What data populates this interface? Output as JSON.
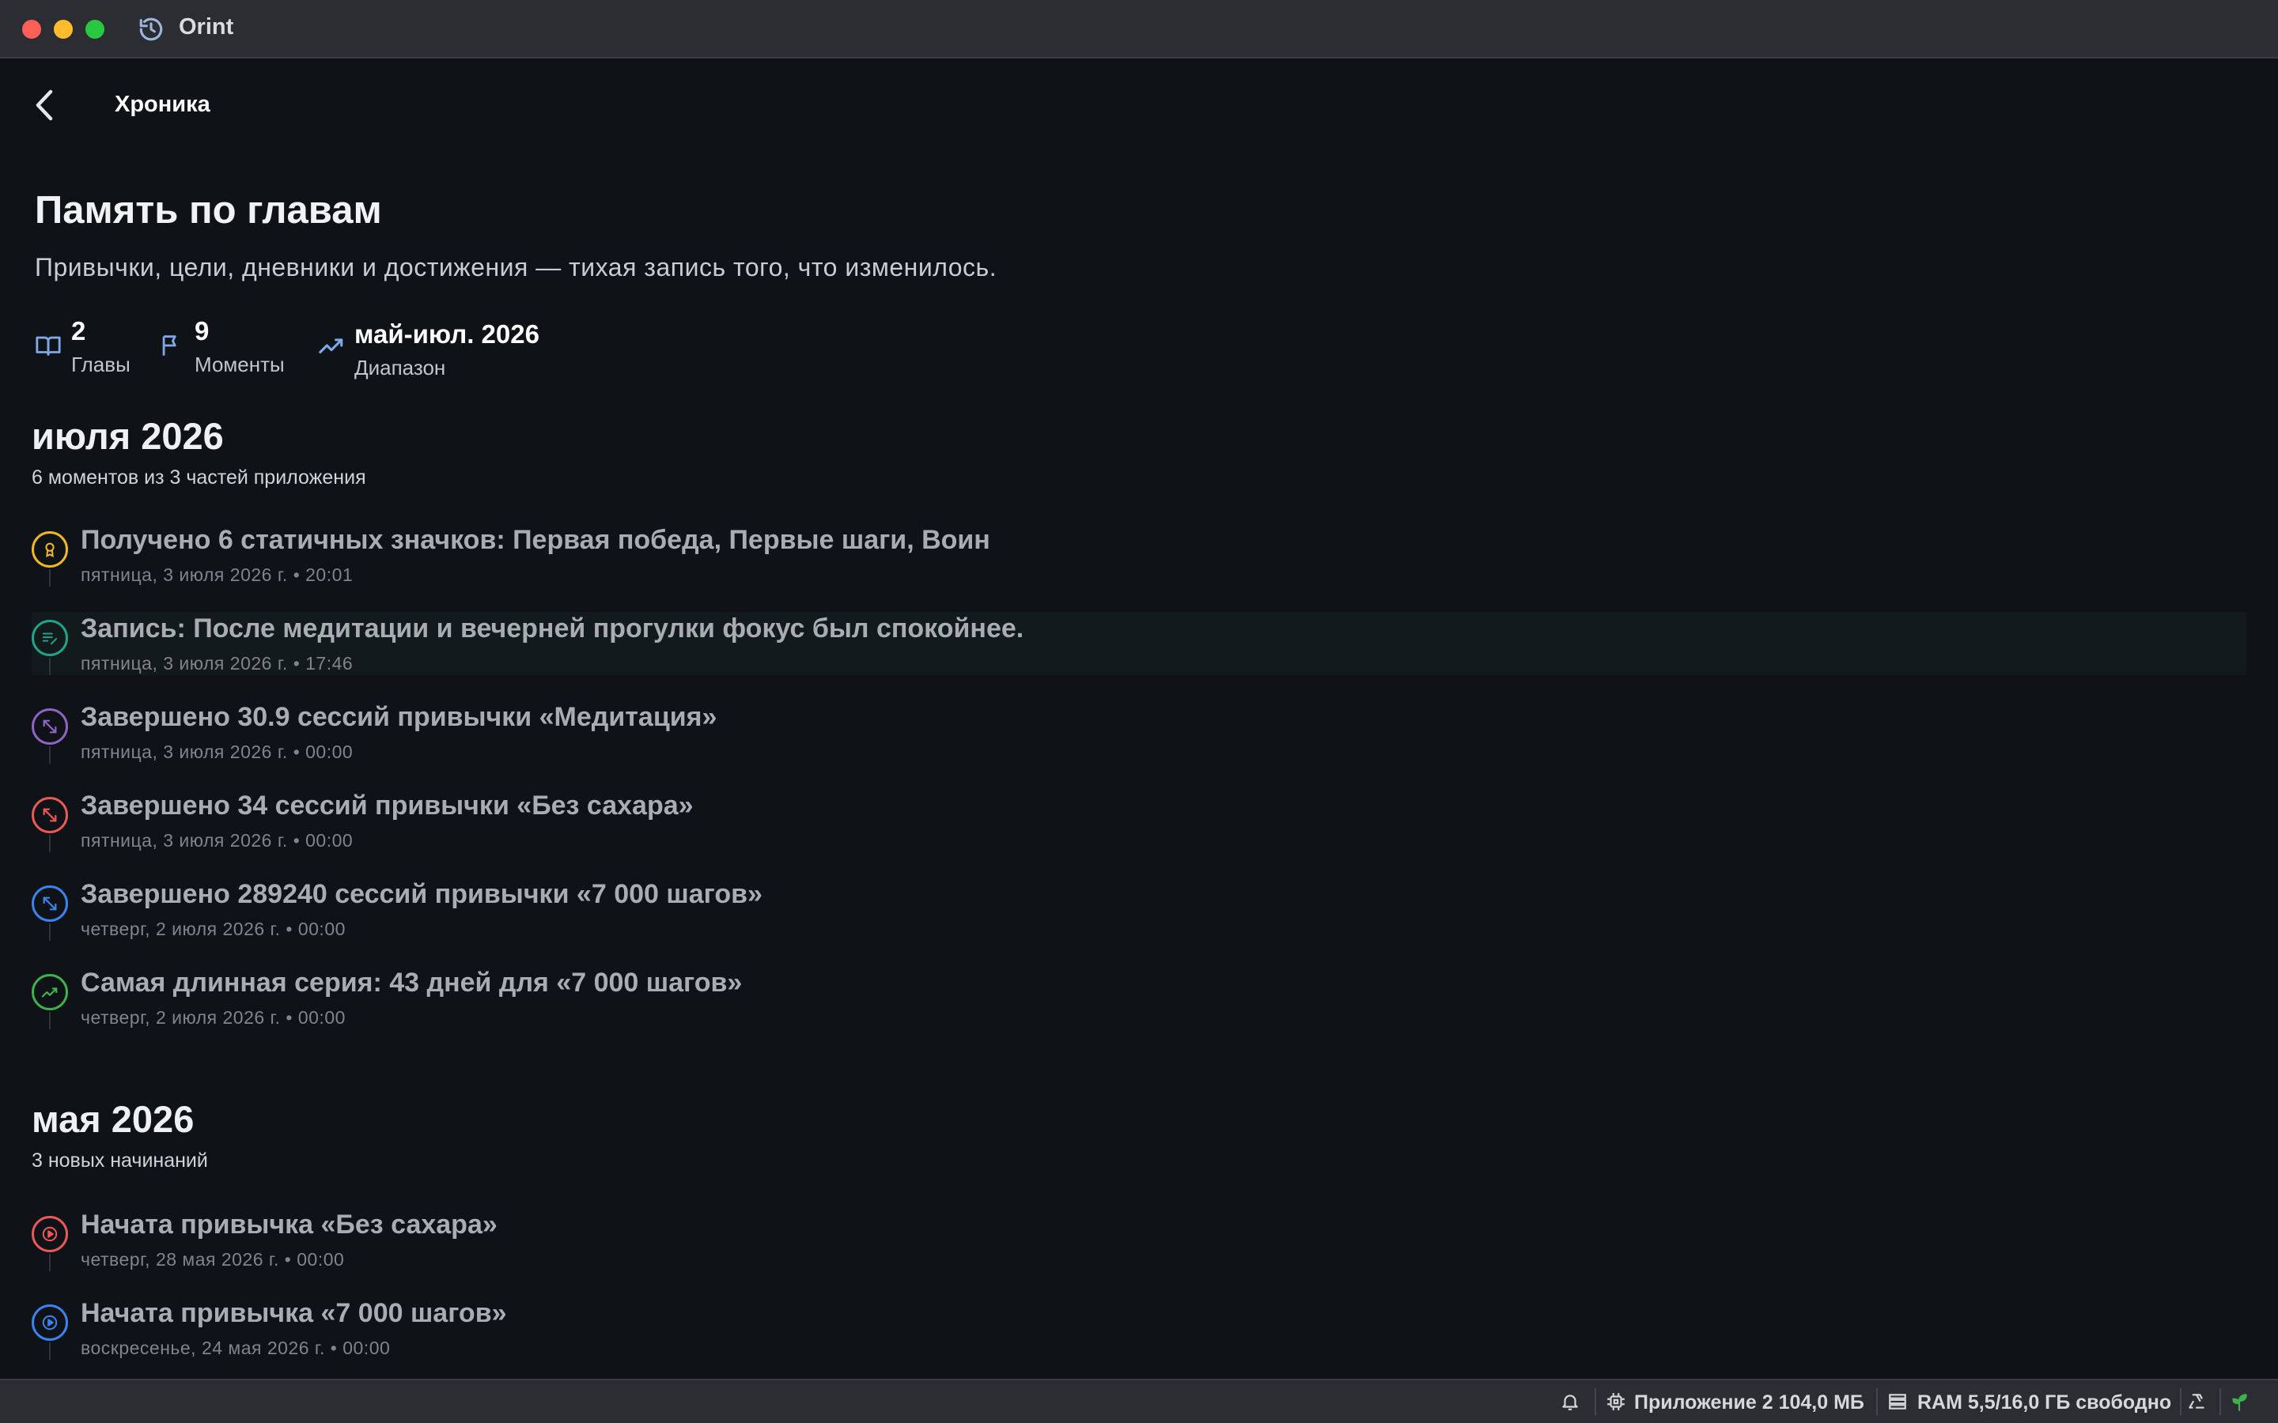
{
  "app": {
    "title": "Orint"
  },
  "header": {
    "title": "Хроника"
  },
  "page": {
    "title": "Память по главам",
    "subtitle": "Привычки, цели, дневники и достижения — тихая запись того, что изменилось."
  },
  "stats": [
    {
      "value": "2",
      "label": "Главы",
      "icon": "book-icon"
    },
    {
      "value": "9",
      "label": "Моменты",
      "icon": "flag-icon"
    },
    {
      "value": "май-июл. 2026",
      "label": "Диапазон",
      "icon": "trend-icon"
    }
  ],
  "sections": [
    {
      "title": "июля 2026",
      "subtitle": "6 моментов из 3 частей приложения",
      "events": [
        {
          "title": "Получено 6 статичных значков: Первая победа, Первые шаги, Воин",
          "date": "пятница, 3 июля 2026 г. • 20:01",
          "icon": "badge-icon",
          "color": "#f2b824"
        },
        {
          "title": "Запись: После медитации и вечерней прогулки фокус был спокойнее.",
          "date": "пятница, 3 июля 2026 г. • 17:46",
          "icon": "journal-icon",
          "color": "#1fa38a"
        },
        {
          "title": "Завершено 30.9 сессий привычки «Медитация»",
          "date": "пятница, 3 июля 2026 г. • 00:00",
          "icon": "arrows-icon",
          "color": "#8e63c4"
        },
        {
          "title": "Завершено 34 сессий привычки «Без сахара»",
          "date": "пятница, 3 июля 2026 г. • 00:00",
          "icon": "arrows-icon",
          "color": "#e85a57"
        },
        {
          "title": "Завершено 289240 сессий привычки «7 000 шагов»",
          "date": "четверг, 2 июля 2026 г. • 00:00",
          "icon": "arrows-icon",
          "color": "#3a84f0"
        },
        {
          "title": "Самая длинная серия: 43 дней для «7 000 шагов»",
          "date": "четверг, 2 июля 2026 г. • 00:00",
          "icon": "trend-icon",
          "color": "#3fb24d"
        }
      ]
    },
    {
      "title": "мая 2026",
      "subtitle": "3 новых начинаний",
      "events": [
        {
          "title": "Начата привычка «Без сахара»",
          "date": "четверг, 28 мая 2026 г. • 00:00",
          "icon": "play-icon",
          "color": "#e85a57"
        },
        {
          "title": "Начата привычка «7 000 шагов»",
          "date": "воскресенье, 24 мая 2026 г. • 00:00",
          "icon": "play-icon",
          "color": "#3a84f0"
        }
      ]
    }
  ],
  "statusbar": {
    "app_memory": "Приложение 2 104,0 МБ",
    "ram": "RAM 5,5/16,0 ГБ свободно"
  }
}
